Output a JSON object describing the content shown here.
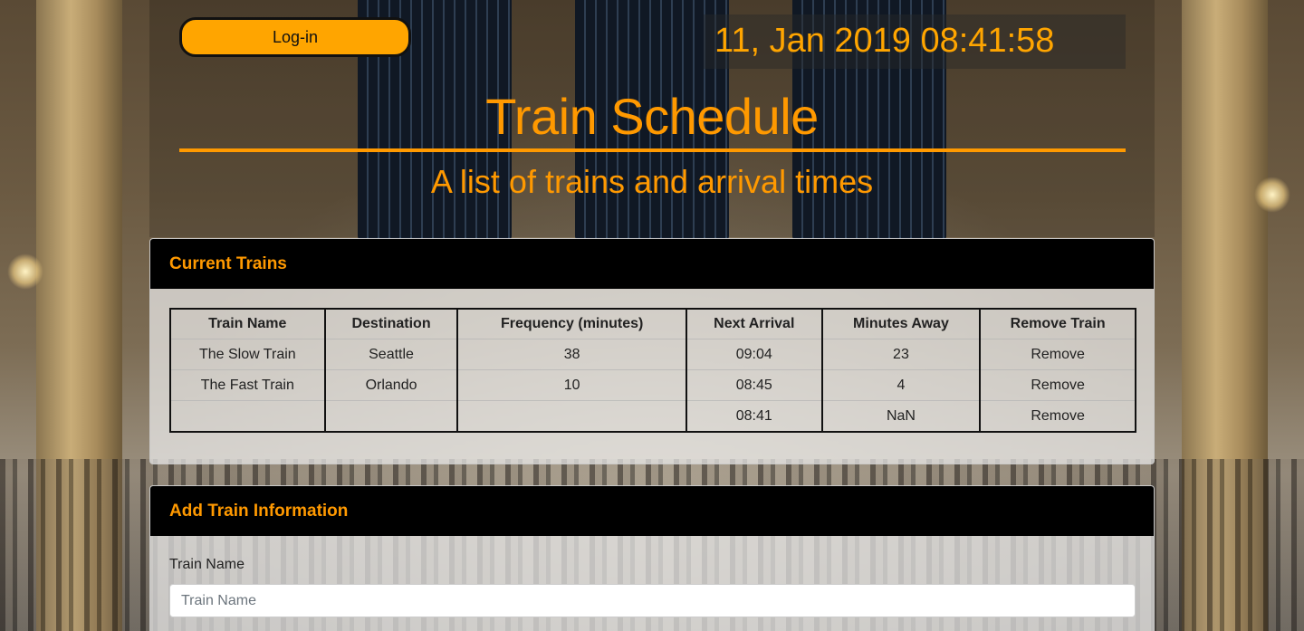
{
  "header": {
    "login_label": "Log-in",
    "clock": "11, Jan 2019 08:41:58",
    "title": "Train Schedule",
    "subtitle": "A list of trains and arrival times"
  },
  "current_trains": {
    "heading": "Current Trains",
    "columns": [
      "Train Name",
      "Destination",
      "Frequency (minutes)",
      "Next Arrival",
      "Minutes Away",
      "Remove Train"
    ],
    "rows": [
      {
        "name": "The Slow Train",
        "destination": "Seattle",
        "frequency": "38",
        "next_arrival": "09:04",
        "minutes_away": "23",
        "remove": "Remove"
      },
      {
        "name": "The Fast Train",
        "destination": "Orlando",
        "frequency": "10",
        "next_arrival": "08:45",
        "minutes_away": "4",
        "remove": "Remove"
      },
      {
        "name": "",
        "destination": "",
        "frequency": "",
        "next_arrival": "08:41",
        "minutes_away": "NaN",
        "remove": "Remove"
      }
    ]
  },
  "add_train": {
    "heading": "Add Train Information",
    "train_name_label": "Train Name",
    "train_name_placeholder": "Train Name",
    "train_name_value": ""
  },
  "colors": {
    "accent": "#ff9900",
    "button": "#ffa500",
    "card_header_bg": "#000000"
  }
}
